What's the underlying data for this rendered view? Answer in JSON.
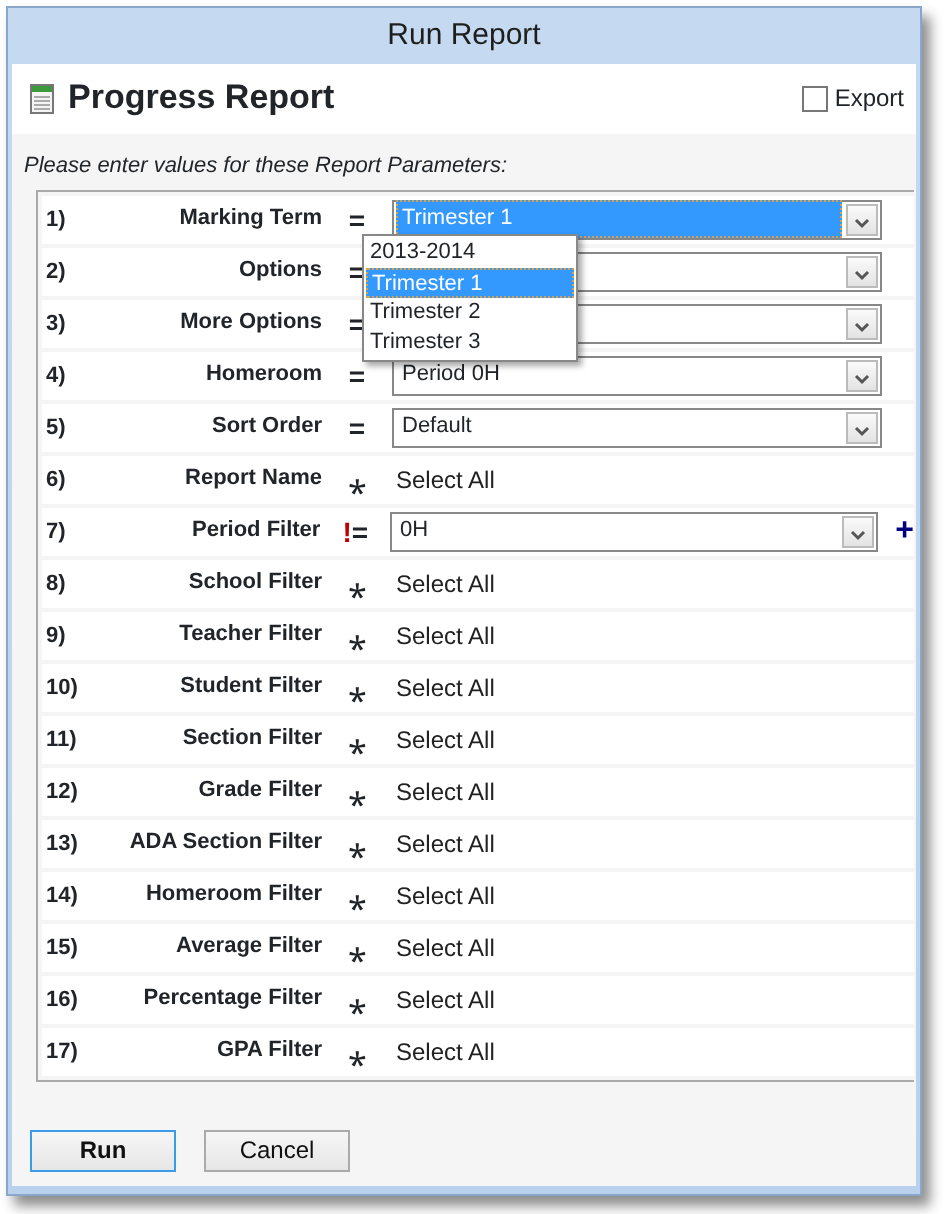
{
  "window": {
    "title": "Run Report"
  },
  "header": {
    "title": "Progress Report",
    "export": {
      "label": "Export",
      "checked": false
    }
  },
  "instructions": "Please enter values for these Report Parameters:",
  "parameters": [
    {
      "number": "1)",
      "label": "Marking Term",
      "operator": "=",
      "kind": "select",
      "value": "Trimester 1",
      "focused": true
    },
    {
      "number": "2)",
      "label": "Options",
      "operator": "=",
      "kind": "select",
      "focused": false
    },
    {
      "number": "3)",
      "label": "More Options",
      "operator": "=",
      "kind": "select",
      "focused": false
    },
    {
      "number": "4)",
      "label": "Homeroom",
      "operator": "=",
      "kind": "select",
      "value": "Period 0H",
      "focused": false
    },
    {
      "number": "5)",
      "label": "Sort Order",
      "operator": "=",
      "kind": "select",
      "value": "Default",
      "focused": false
    },
    {
      "number": "6)",
      "label": "Report Name",
      "operator": "⁎",
      "kind": "all",
      "value": "Select All"
    },
    {
      "number": "7)",
      "label": "Period Filter",
      "operator_flag": "!",
      "operator": "=",
      "kind": "select",
      "value": "0H",
      "focused": false,
      "add": "+"
    },
    {
      "number": "8)",
      "label": "School Filter",
      "operator": "⁎",
      "kind": "all",
      "value": "Select All"
    },
    {
      "number": "9)",
      "label": "Teacher Filter",
      "operator": "⁎",
      "kind": "all",
      "value": "Select All"
    },
    {
      "number": "10)",
      "label": "Student Filter",
      "operator": "⁎",
      "kind": "all",
      "value": "Select All"
    },
    {
      "number": "11)",
      "label": "Section Filter",
      "operator": "⁎",
      "kind": "all",
      "value": "Select All"
    },
    {
      "number": "12)",
      "label": "Grade Filter",
      "operator": "⁎",
      "kind": "all",
      "value": "Select All"
    },
    {
      "number": "13)",
      "label": "ADA Section Filter",
      "operator": "⁎",
      "kind": "all",
      "value": "Select All"
    },
    {
      "number": "14)",
      "label": "Homeroom Filter",
      "operator": "⁎",
      "kind": "all",
      "value": "Select All"
    },
    {
      "number": "15)",
      "label": "Average Filter",
      "operator": "⁎",
      "kind": "all",
      "value": "Select All"
    },
    {
      "number": "16)",
      "label": "Percentage Filter",
      "operator": "⁎",
      "kind": "all",
      "value": "Select All"
    },
    {
      "number": "17)",
      "label": "GPA Filter",
      "operator": "⁎",
      "kind": "all",
      "value": "Select All"
    }
  ],
  "open_dropdown": {
    "options": [
      {
        "label": "2013-2014",
        "selected": false
      },
      {
        "label": "Trimester 1",
        "selected": true
      },
      {
        "label": "Trimester 2",
        "selected": false
      },
      {
        "label": "Trimester 3",
        "selected": false
      }
    ]
  },
  "buttons": [
    {
      "label": "Run",
      "default": true
    },
    {
      "label": "Cancel",
      "default": false
    }
  ]
}
